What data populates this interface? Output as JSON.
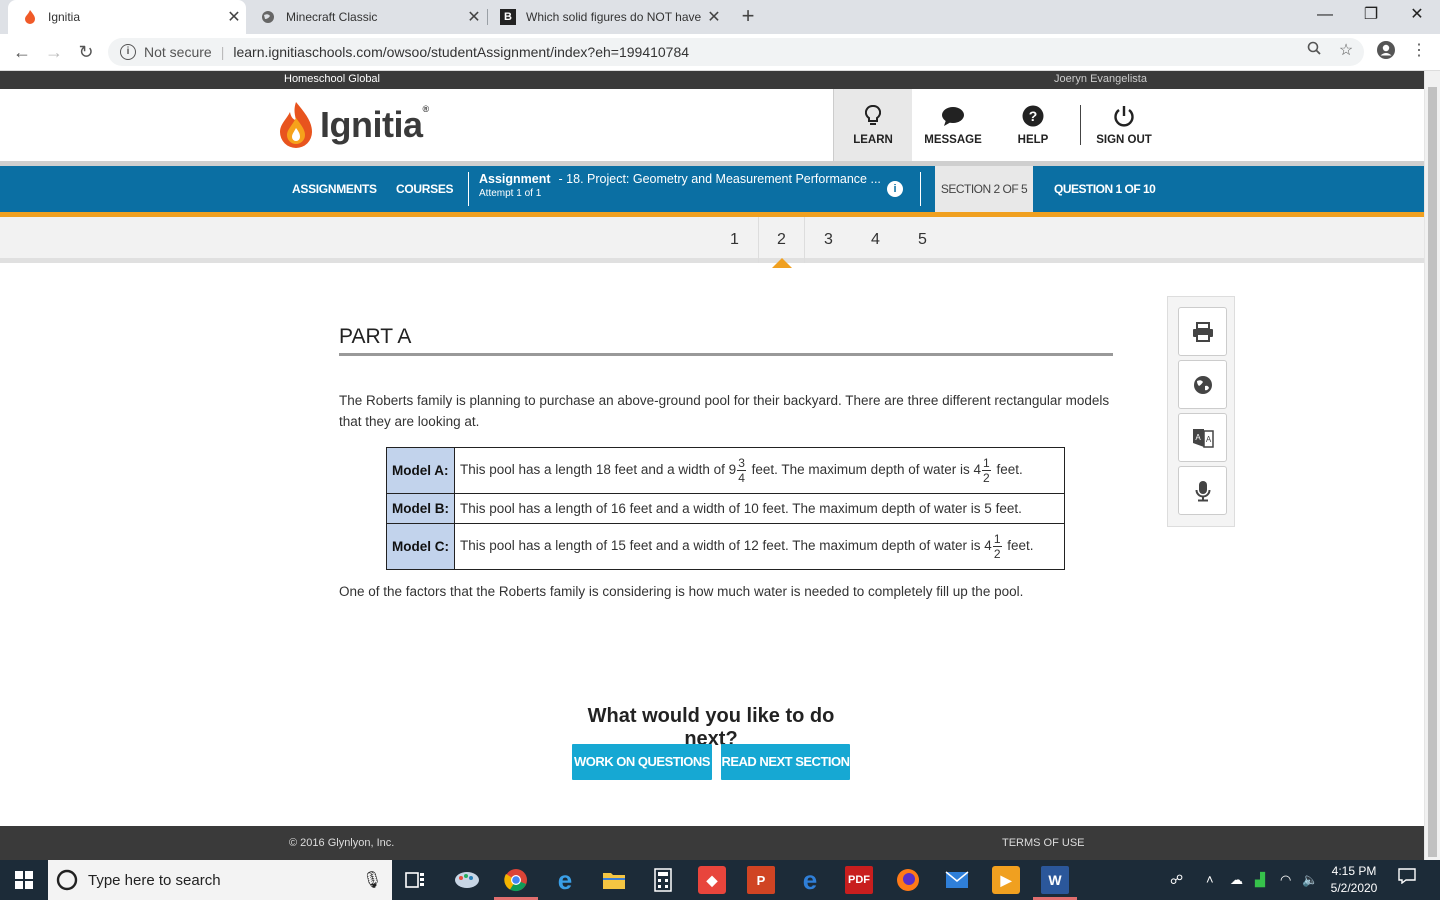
{
  "browser": {
    "tabs": [
      {
        "title": "Ignitia",
        "active": true
      },
      {
        "title": "Minecraft Classic",
        "active": false
      },
      {
        "title": "Which solid figures do NOT have",
        "active": false
      }
    ],
    "security_label": "Not secure",
    "url": "learn.ignitiaschools.com/owsoo/studentAssignment/index?eh=199410784"
  },
  "site": {
    "org_name": "Homeschool Global",
    "user_name": "Joeryn Evangelista",
    "logo_text": "Ignitia",
    "logo_mark": "®",
    "header_nav": [
      {
        "label": "LEARN"
      },
      {
        "label": "MESSAGE"
      },
      {
        "label": "HELP"
      },
      {
        "label": "SIGN OUT"
      }
    ],
    "main_nav": {
      "assignments": "ASSIGNMENTS",
      "courses": "COURSES",
      "assignment_label": "Assignment",
      "assignment_title": "- 18. Project: Geometry and Measurement Performance ...",
      "attempt": "Attempt 1 of 1",
      "info_icon": "i",
      "section": "SECTION 2 OF 5",
      "question": "QUESTION 1 OF 10"
    },
    "sections": [
      "1",
      "2",
      "3",
      "4",
      "5"
    ],
    "current_section": "2"
  },
  "content": {
    "heading": "PART A",
    "intro": "The Roberts family is planning to purchase an above-ground pool for their backyard. There are three different rectangular models that they are looking at.",
    "models": [
      {
        "label": "Model A:",
        "text_1": "This pool has a length 18 feet and a width of 9",
        "frac1": {
          "num": "3",
          "den": "4"
        },
        "text_2": " feet. The maximum depth of water is 4",
        "frac2": {
          "num": "1",
          "den": "2"
        },
        "text_3": " feet."
      },
      {
        "label": "Model B:",
        "text": "This pool has a length of 16 feet and a width of 10 feet. The maximum depth of water is 5 feet."
      },
      {
        "label": "Model C:",
        "text_1": "This pool has a length of 15 feet and a width of 12 feet. The maximum depth of water is 4",
        "frac": {
          "num": "1",
          "den": "2"
        },
        "text_2": " feet."
      }
    ],
    "factor_text": "One of the factors that the Roberts family is considering is how much water is needed to completely fill up the pool.",
    "next_heading": "What would you like to do next?",
    "btn_questions": "WORK ON QUESTIONS",
    "btn_next": "READ NEXT SECTION"
  },
  "tools": [
    "print-icon",
    "globe-icon",
    "translate-icon",
    "microphone-icon"
  ],
  "footer": {
    "copyright": "© 2016 Glynlyon, Inc.",
    "terms": "TERMS OF USE"
  },
  "taskbar": {
    "search_placeholder": "Type here to search",
    "time": "4:15 PM",
    "date": "5/2/2020"
  },
  "colors": {
    "primary_blue": "#0b6fa3",
    "accent_orange": "#f0a020",
    "button_cyan": "#16a8d3",
    "table_label_bg": "#c2d3ec"
  }
}
